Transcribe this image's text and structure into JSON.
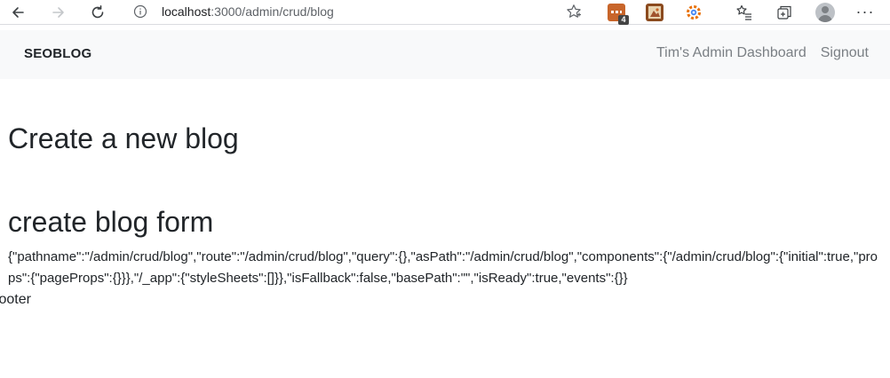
{
  "browser": {
    "url_host": "localhost",
    "url_rest": ":3000/admin/crud/blog",
    "extension_badge": "4",
    "icons": {
      "back": "arrow-left-icon",
      "forward": "arrow-right-icon",
      "reload": "reload-icon",
      "info": "info-icon",
      "favorite": "star-icon",
      "collections": "collections-icon",
      "more": "more-icon"
    }
  },
  "navbar": {
    "brand": "SEOBLOG",
    "links": [
      "Tim's Admin Dashboard",
      "Signout"
    ]
  },
  "page": {
    "title": "Create a new blog",
    "form_heading": "create blog form",
    "router_json": "{\"pathname\":\"/admin/crud/blog\",\"route\":\"/admin/crud/blog\",\"query\":{},\"asPath\":\"/admin/crud/blog\",\"components\":{\"/admin/crud/blog\":{\"initial\":true,\"props\":{\"pageProps\":{}}},\"/_app\":{\"styleSheets\":[]}},\"isFallback\":false,\"basePath\":\"\",\"isReady\":true,\"events\":{}}",
    "footer": "footer"
  },
  "colors": {
    "navbar_bg": "#f8f9fa",
    "nav_link": "#7a7f84",
    "text": "#212529"
  }
}
